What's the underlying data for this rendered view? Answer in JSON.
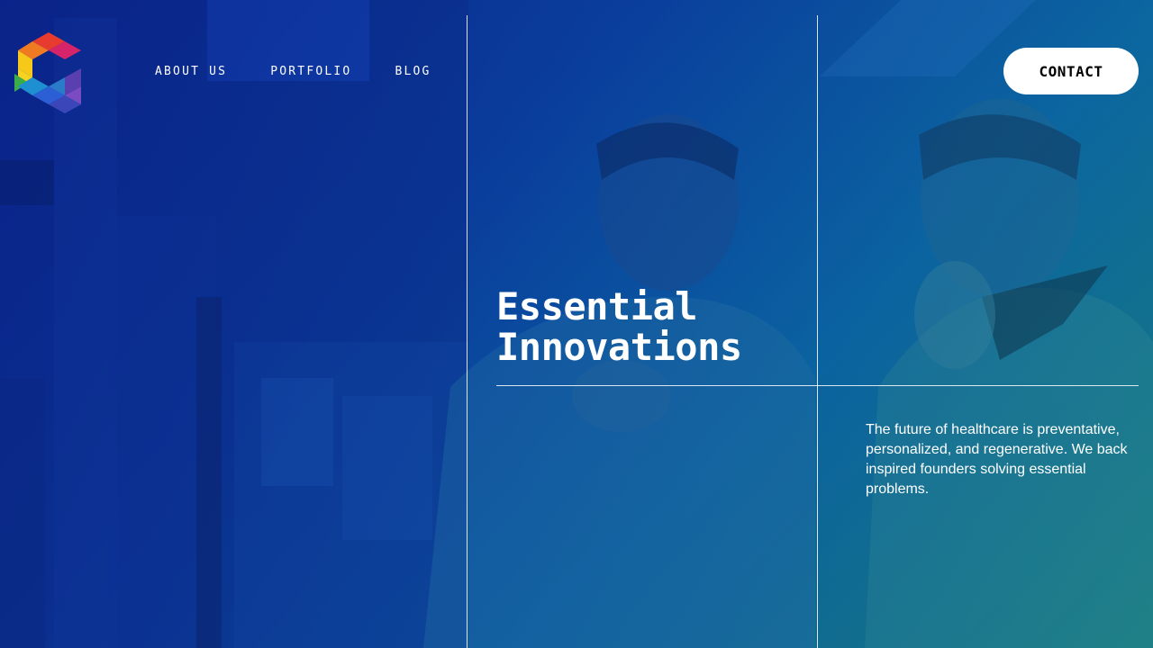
{
  "nav": {
    "items": [
      {
        "label": "ABOUT US"
      },
      {
        "label": "PORTFOLIO"
      },
      {
        "label": "BLOG"
      }
    ],
    "contact_label": "CONTACT"
  },
  "hero": {
    "headline_line1": "Essential",
    "headline_line2": "Innovations",
    "description": "The future of healthcare is preventative, personalized, and regenerative. We back inspired founders solving essential problems."
  },
  "icons": {
    "logo": "hexagon-c-logo"
  },
  "colors": {
    "accent_button": "#ffffff",
    "gradient_start": "#0a2a8a",
    "gradient_end": "#1a7d78"
  }
}
